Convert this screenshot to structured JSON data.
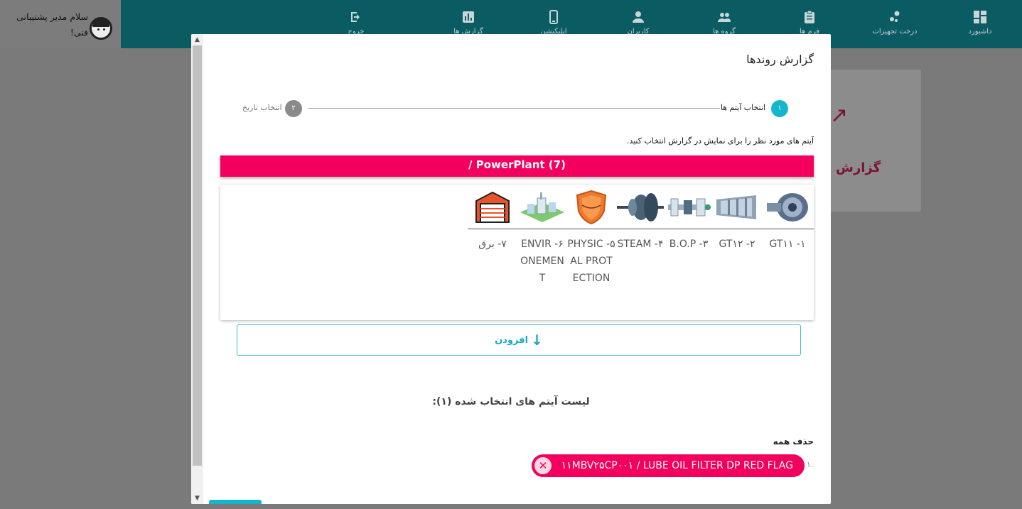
{
  "topbar": {
    "user_greeting": "سلام مدیر پشتیبانی فنی!",
    "nav": [
      {
        "label": "خروج",
        "icon": "logout-icon"
      },
      {
        "label": "گزارش ها",
        "icon": "bar-chart-icon"
      },
      {
        "label": "اپلیکیشن",
        "icon": "mobile-icon"
      },
      {
        "label": "کاربران",
        "icon": "person-icon"
      },
      {
        "label": "گروه ها",
        "icon": "people-icon"
      },
      {
        "label": "فرم ها",
        "icon": "clipboard-icon"
      },
      {
        "label": "درخت تجهیزات",
        "icon": "tree-icon"
      },
      {
        "label": "داشبورد",
        "icon": "dashboard-icon"
      }
    ]
  },
  "background": {
    "card_text": "گزارش"
  },
  "modal": {
    "title": "گزارش روندها",
    "steps": [
      {
        "number": "۱",
        "label": "انتخاب آیتم ها",
        "active": true
      },
      {
        "number": "۲",
        "label": "انتخاب تاریخ",
        "active": false
      }
    ],
    "instruction": "آیتم های مورد نظر را برای نمایش در گزارش انتخاب کنید.",
    "path": "/ PowerPlant (7)",
    "items": [
      {
        "label": "۱- GT۱۱",
        "icon": "gas-turbine-icon"
      },
      {
        "label": "۲- GT۱۲",
        "icon": "gas-turbine-icon"
      },
      {
        "label": "۳- B.O.P",
        "icon": "piping-plant-icon"
      },
      {
        "label": "۴- STEAM",
        "icon": "steam-turbine-icon"
      },
      {
        "label": "۵- PHYSICAL PROTECTION",
        "icon": "shield-icon"
      },
      {
        "label": "۶- ENVIRONEMENT",
        "icon": "factory-icon"
      },
      {
        "label": "۷- برق",
        "icon": "garage-icon"
      }
    ],
    "add_button": "افزودن",
    "selected_heading": "لیست آیتم های انتخاب شده (۱):",
    "delete_all": "حذف همه",
    "selected": [
      {
        "index": "۱.",
        "label": "۱۱MBV۲۵CP۰۰۱ / LUBE OIL FILTER DP RED FLAG"
      }
    ]
  },
  "colors": {
    "primary": "#14b6cb",
    "accent": "#f3005e",
    "topbar": "#0b5b63"
  }
}
